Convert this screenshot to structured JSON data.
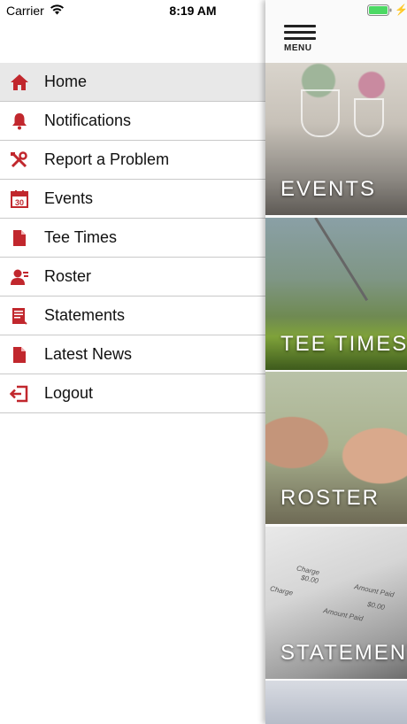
{
  "status_bar": {
    "carrier": "Carrier",
    "time": "8:19 AM",
    "battery_color": "#4cd964"
  },
  "menu": {
    "items": [
      {
        "label": "Home",
        "icon": "home-icon",
        "active": true
      },
      {
        "label": "Notifications",
        "icon": "bell-icon"
      },
      {
        "label": "Report a Problem",
        "icon": "tools-icon"
      },
      {
        "label": "Events",
        "icon": "calendar-icon",
        "icon_text": "30"
      },
      {
        "label": "Tee Times",
        "icon": "document-icon"
      },
      {
        "label": "Roster",
        "icon": "people-icon"
      },
      {
        "label": "Statements",
        "icon": "statement-icon"
      },
      {
        "label": "Latest News",
        "icon": "document-icon"
      },
      {
        "label": "Logout",
        "icon": "logout-icon"
      }
    ],
    "accent_color": "#c1272d"
  },
  "main": {
    "menu_button_label": "MENU",
    "tiles": [
      {
        "label": "EVENTS"
      },
      {
        "label": "TEE TIMES"
      },
      {
        "label": "ROSTER"
      },
      {
        "label": "STATEMENTS"
      }
    ],
    "statement_snippets": [
      "Charge",
      "Amount Paid",
      "Charge",
      "$0.00",
      "Amount Paid",
      "$0.00"
    ]
  }
}
